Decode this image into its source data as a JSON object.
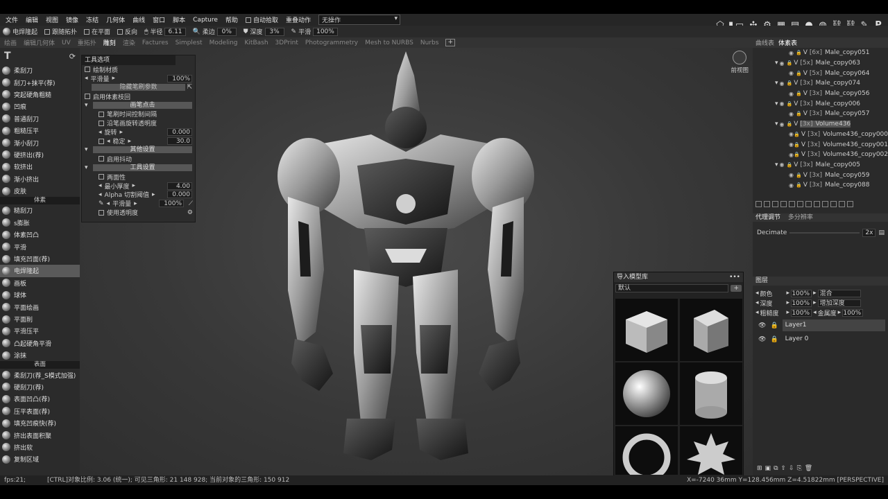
{
  "menubar": {
    "items": [
      "文件",
      "编辑",
      "视图",
      "镜像",
      "冻结",
      "几何体",
      "曲线",
      "窗口",
      "脚本",
      "Capture",
      "帮助"
    ],
    "auto_pick": "自动拾取",
    "repeat_action_label": "重叠动作",
    "repeat_action_value": "无操作"
  },
  "toolbar": {
    "tool_name": "电焊隆起",
    "follow_topology": "跟随拓扑",
    "on_plane": "在平面",
    "invert": "反向",
    "radius_label": "半径",
    "radius_value": "6.11",
    "falloff_label": "柔边",
    "falloff_value": "0%",
    "depth_label": "深度",
    "depth_value": "3%",
    "smooth_label": "平滑",
    "smooth_value": "100%"
  },
  "room_tabs": [
    "绘画",
    "编辑几何体",
    "UV",
    "重拓扑",
    "雕刻",
    "渲染",
    "Factures",
    "Simplest",
    "Modeling",
    "KitBash",
    "3DPrint",
    "Photogrammetry",
    "Mesh to NURBS",
    "Nurbs"
  ],
  "active_room": "雕刻",
  "left_panel": {
    "sections": [
      {
        "title": "",
        "tools": [
          "柔刮刀",
          "刮刀+抹平(荐)",
          "突起硬角粗糙",
          "凹痕",
          "普通刮刀",
          "粗糙压平",
          "渐小刮刀",
          "硬挤出(荐)",
          "软挤出",
          "渐小挤出",
          "皮肤"
        ]
      },
      {
        "title": "体素",
        "tools": [
          "糙刮刀",
          "s膨胀",
          "体素凹凸",
          "平滑",
          "填充凹面(荐)",
          "电焊隆起",
          "画板",
          "球体",
          "平面绘画",
          "平面削",
          "平滑压平",
          "凸起硬角平滑",
          "涂抹"
        ]
      },
      {
        "title": "表面",
        "tools": [
          "柔刮刀(荐_S模式加强)",
          "硬刮刀(荐)",
          "表面凹凸(荐)",
          "压平表面(荐)",
          "填充凹痕快(荐)",
          "挤出表面积聚",
          "挤出软",
          "复制区域"
        ]
      }
    ],
    "active_tool": "电焊隆起"
  },
  "tool_options": {
    "title": "工具选项",
    "draw_material": "绘制材质",
    "smooth_label": "平滑量",
    "smooth_value": "100%",
    "hide_brush_params": "隐藏笔刷参数",
    "enable_voxel_trace": "启用体素枝回",
    "brush_point_header": "画笔点击",
    "brush_time_control": "笔刷时间控制间隔",
    "rotate_along_stroke": "沿笔画旋转透明度",
    "rotation_label": "旋转",
    "rotation_value": "0.000",
    "fixed_label": "稳定",
    "fixed_value": "30.0",
    "other_settings_header": "其他设置",
    "enable_jitter": "启用抖动",
    "tool_settings_header": "工具设置",
    "two_sided": "两面性",
    "min_thickness_label": "最小厚度",
    "min_thickness_value": "4.00",
    "alpha_cutoff_label": "Alpha  切割阈值",
    "alpha_cutoff_value": "0.000",
    "smooth2_label": "平滑量",
    "smooth2_value": "100%",
    "use_transparency": "使用透明度"
  },
  "viewport": {
    "perspective_label": "前视图"
  },
  "right_panel": {
    "tabs": [
      "曲线表",
      "体素表"
    ],
    "active_tab": "体素表",
    "volumes": [
      {
        "name": "Male_copy051",
        "count": "[6x]",
        "level": 2,
        "selected": false
      },
      {
        "name": "Male_copy063",
        "count": "[5x]",
        "level": 1,
        "selected": false
      },
      {
        "name": "Male_copy064",
        "count": "[5x]",
        "level": 2,
        "selected": false
      },
      {
        "name": "Male_copy074",
        "count": "[3x]",
        "level": 1,
        "selected": false
      },
      {
        "name": "Male_copy056",
        "count": "[3x]",
        "level": 2,
        "selected": false
      },
      {
        "name": "Male_copy006",
        "count": "[3x]",
        "level": 1,
        "selected": false
      },
      {
        "name": "Male_copy057",
        "count": "[3x]",
        "level": 2,
        "selected": false
      },
      {
        "name": "Volume436",
        "count": "[3x]",
        "level": 1,
        "selected": true
      },
      {
        "name": "Volume436_copy000",
        "count": "[3x]",
        "level": 2,
        "selected": false
      },
      {
        "name": "Volume436_copy001",
        "count": "[3x]",
        "level": 2,
        "selected": false
      },
      {
        "name": "Volume436_copy002",
        "count": "[3x]",
        "level": 2,
        "selected": false
      },
      {
        "name": "Male_copy005",
        "count": "[3x]",
        "level": 1,
        "selected": false
      },
      {
        "name": "Male_copy059",
        "count": "[3x]",
        "level": 2,
        "selected": false
      },
      {
        "name": "Male_copy088",
        "count": "[3x]",
        "level": 2,
        "selected": false
      }
    ],
    "proxy_tabs": [
      "代理调节",
      "多分辨率"
    ],
    "decimate_label": "Decimate",
    "decimate_value": "2x",
    "layers_header": "图层",
    "color_label": "颜色",
    "color_value": "100%",
    "color_mode": "混合",
    "depth_label": "深度",
    "depth_value": "100%",
    "depth_mode": "增加深度",
    "roughness_label": "粗糙度",
    "roughness_value": "100%",
    "metal_label": "金属度",
    "metal_value": "100%",
    "layers": [
      "Layer1",
      "Layer 0"
    ],
    "active_layer": "Layer1"
  },
  "model_library": {
    "title": "导入模型库",
    "preset": "默认",
    "items": [
      "cube-rounded",
      "cube-sharp",
      "sphere",
      "cylinder",
      "torus",
      "spiky-ball"
    ]
  },
  "status": {
    "fps": "fps:21;",
    "info": "[CTRL]对象比例: 3.06 (统一); 可见三角形: 21 148 928; 当前对象的三角形: 150 912",
    "coords": "X=-7240 36mm  Y=128.456mm  Z=4.51822mm [PERSPECTIVE]"
  }
}
